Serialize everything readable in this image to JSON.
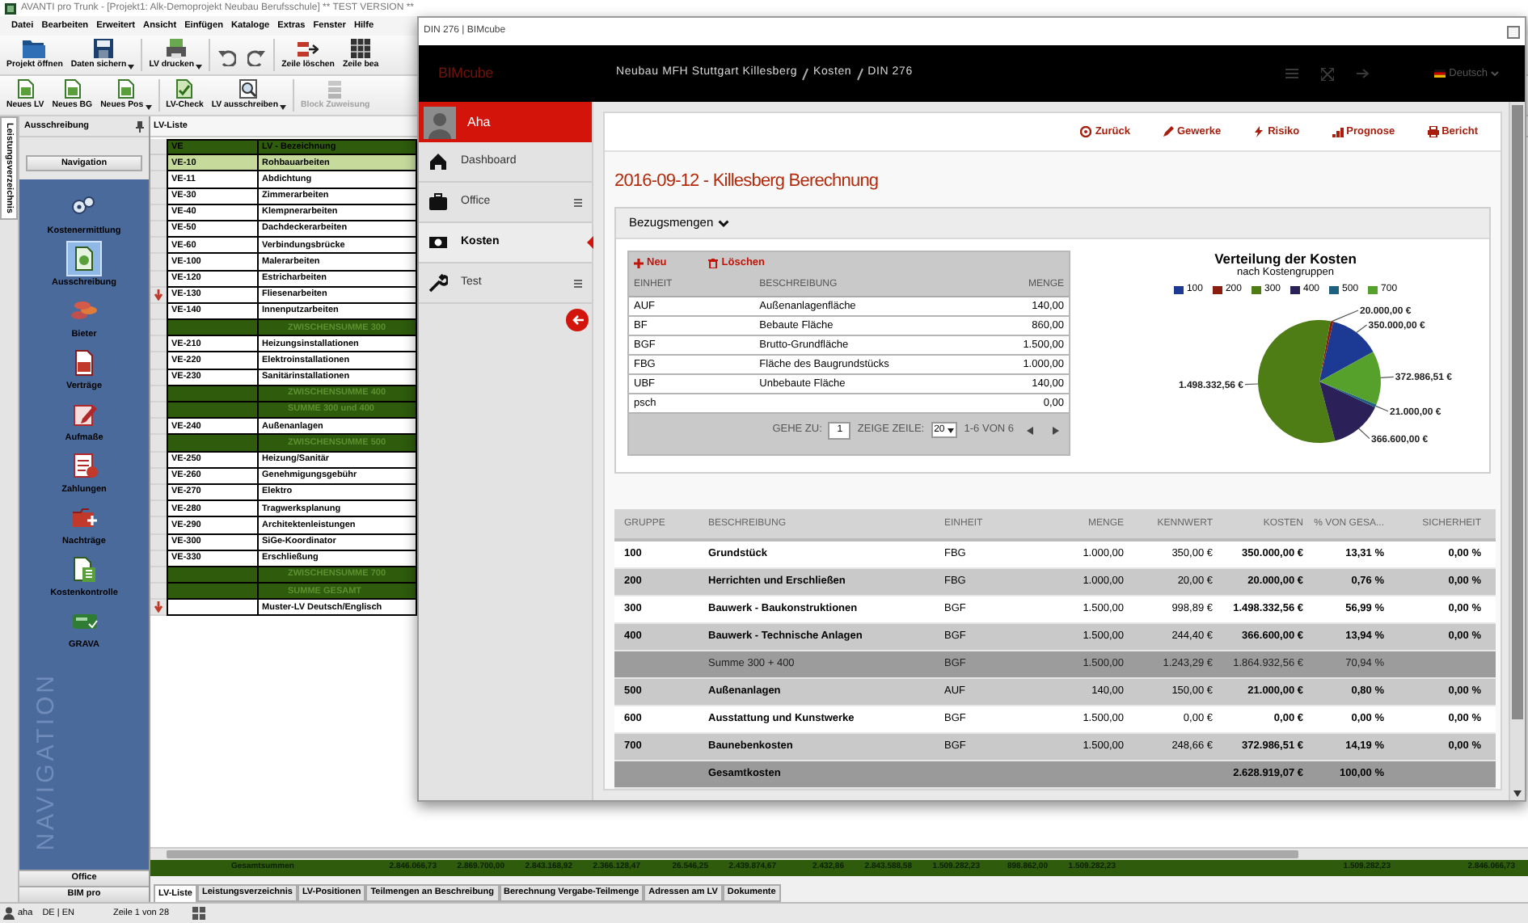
{
  "back_window": {
    "title": "AVANTI pro Trunk - [Projekt1: Alk-Demoprojekt Neubau Berufsschule]  ** TEST VERSION **",
    "menu": [
      "Datei",
      "Bearbeiten",
      "Erweitert",
      "Ansicht",
      "Einfügen",
      "Kataloge",
      "Extras",
      "Fenster",
      "Hilfe"
    ],
    "toolbar_rows": [
      [
        [
          {
            "kind": "button",
            "label": "Projekt öffnen",
            "dropdown": false,
            "disabled": false
          },
          {
            "kind": "button",
            "label": "Daten sichern",
            "dropdown": true,
            "disabled": false
          }
        ],
        [
          {
            "kind": "button",
            "label": "LV drucken",
            "dropdown": true,
            "disabled": false
          }
        ],
        [
          {
            "kind": "undo"
          },
          {
            "kind": "redo"
          }
        ],
        [
          {
            "kind": "button",
            "label": "Zeile löschen",
            "dropdown": false,
            "disabled": false
          },
          {
            "kind": "button",
            "label": "Zeile bea",
            "dropdown": false,
            "disabled": false
          }
        ]
      ],
      [
        [
          {
            "kind": "button",
            "label": "Neues LV",
            "dropdown": false,
            "disabled": false
          },
          {
            "kind": "button",
            "label": "Neues BG",
            "dropdown": false,
            "disabled": false
          },
          {
            "kind": "button",
            "label": "Neues Pos",
            "dropdown": true,
            "disabled": false
          }
        ],
        [
          {
            "kind": "button",
            "label": "LV-Check",
            "dropdown": false,
            "disabled": false
          },
          {
            "kind": "button",
            "label": "LV ausschreiben",
            "dropdown": true,
            "disabled": false
          }
        ],
        [
          {
            "kind": "button",
            "label": "Block Zuweisung",
            "dropdown": false,
            "disabled": true
          }
        ]
      ]
    ],
    "side_tab": "Leistungsverzeichnis",
    "panel_title": "Ausschreibung",
    "navigation_button": "Navigation",
    "nav_items": [
      {
        "label": "Kostenermittlung",
        "selected": false
      },
      {
        "label": "Ausschreibung",
        "selected": true
      },
      {
        "label": "Bieter",
        "selected": false
      },
      {
        "label": "Verträge",
        "selected": false
      },
      {
        "label": "Aufmaße",
        "selected": false
      },
      {
        "label": "Zahlungen",
        "selected": false
      },
      {
        "label": "Nachträge",
        "selected": false
      },
      {
        "label": "Kostenkontrolle",
        "selected": false
      },
      {
        "label": "GRAVA",
        "selected": false
      }
    ],
    "nav_watermark": "NAVIGATION",
    "nav_footer": [
      "Office",
      "BIM pro"
    ],
    "list_title": "LV-Liste",
    "lv_table": {
      "columns": [
        "VE",
        "LV - Bezeichnung"
      ],
      "rows": [
        {
          "kind": "item",
          "ve": "VE-10",
          "name": "Rohbauarbeiten",
          "selected": true,
          "flagged": false
        },
        {
          "kind": "item",
          "ve": "VE-11",
          "name": "Abdichtung",
          "selected": false,
          "flagged": false
        },
        {
          "kind": "item",
          "ve": "VE-30",
          "name": "Zimmerarbeiten",
          "selected": false,
          "flagged": false
        },
        {
          "kind": "item",
          "ve": "VE-40",
          "name": "Klempnerarbeiten",
          "selected": false,
          "flagged": false
        },
        {
          "kind": "item",
          "ve": "VE-50",
          "name": "Dachdeckerarbeiten",
          "selected": false,
          "flagged": false
        },
        {
          "kind": "item",
          "ve": "VE-60",
          "name": "Verbindungsbrücke",
          "selected": false,
          "flagged": false
        },
        {
          "kind": "item",
          "ve": "VE-100",
          "name": "Malerarbeiten",
          "selected": false,
          "flagged": false
        },
        {
          "kind": "item",
          "ve": "VE-120",
          "name": "Estricharbeiten",
          "selected": false,
          "flagged": false
        },
        {
          "kind": "item",
          "ve": "VE-130",
          "name": "Fliesenarbeiten",
          "selected": false,
          "flagged": true
        },
        {
          "kind": "item",
          "ve": "VE-140",
          "name": "Innenputzarbeiten",
          "selected": false,
          "flagged": false
        },
        {
          "kind": "subtotal",
          "name": "ZWISCHENSUMME 300",
          "selected": false,
          "flagged": false
        },
        {
          "kind": "item",
          "ve": "VE-210",
          "name": "Heizungsinstallationen",
          "selected": false,
          "flagged": false
        },
        {
          "kind": "item",
          "ve": "VE-220",
          "name": "Elektroinstallationen",
          "selected": false,
          "flagged": false
        },
        {
          "kind": "item",
          "ve": "VE-230",
          "name": "Sanitärinstallationen",
          "selected": false,
          "flagged": false
        },
        {
          "kind": "subtotal",
          "name": "ZWISCHENSUMME 400",
          "selected": false,
          "flagged": false
        },
        {
          "kind": "subtotal",
          "name": "SUMME 300 und 400",
          "selected": false,
          "flagged": false
        },
        {
          "kind": "item",
          "ve": "VE-240",
          "name": "Außenanlagen",
          "selected": false,
          "flagged": false
        },
        {
          "kind": "subtotal",
          "name": "ZWISCHENSUMME 500",
          "selected": false,
          "flagged": false
        },
        {
          "kind": "item",
          "ve": "VE-250",
          "name": "Heizung/Sanitär",
          "selected": false,
          "flagged": false
        },
        {
          "kind": "item",
          "ve": "VE-260",
          "name": "Genehmigungsgebühr",
          "selected": false,
          "flagged": false
        },
        {
          "kind": "item",
          "ve": "VE-270",
          "name": "Elektro",
          "selected": false,
          "flagged": false
        },
        {
          "kind": "item",
          "ve": "VE-280",
          "name": "Tragwerksplanung",
          "selected": false,
          "flagged": false
        },
        {
          "kind": "item",
          "ve": "VE-290",
          "name": "Architektenleistungen",
          "selected": false,
          "flagged": false
        },
        {
          "kind": "item",
          "ve": "VE-300",
          "name": "SiGe-Koordinator",
          "selected": false,
          "flagged": false
        },
        {
          "kind": "item",
          "ve": "VE-330",
          "name": "Erschließung",
          "selected": false,
          "flagged": false
        },
        {
          "kind": "subtotal",
          "name": "ZWISCHENSUMME 700",
          "selected": false,
          "flagged": false
        },
        {
          "kind": "subtotal",
          "name": "SUMME GESAMT",
          "selected": false,
          "flagged": false
        },
        {
          "kind": "item",
          "name": "Muster-LV Deutsch/Englisch",
          "selected": false,
          "flagged": true
        }
      ]
    },
    "totals_row": {
      "label": "Gesamtsummen",
      "values": [
        "2.846.066,73",
        "2.869.700,00",
        "2.843.168,92",
        "2.366.128,47",
        "26.546,25",
        "2.439.874,67",
        "2.432,86",
        "2.843.588,58",
        "1.509.282,23",
        "898.862,00",
        "1.509.282,23"
      ],
      "right_values": [
        "1.509.282,23",
        "2.846.066,73"
      ]
    },
    "bottom_tabs": [
      {
        "label": "LV-Liste",
        "selected": true
      },
      {
        "label": "Leistungsverzeichnis",
        "selected": false
      },
      {
        "label": "LV-Positionen",
        "selected": false
      },
      {
        "label": "Teilmengen an Beschreibung",
        "selected": false
      },
      {
        "label": "Berechnung Vergabe-Teilmenge",
        "selected": false
      },
      {
        "label": "Adressen am LV",
        "selected": false
      },
      {
        "label": "Dokumente",
        "selected": false
      }
    ],
    "status_bar": {
      "user": "aha",
      "languages": "DE | EN",
      "position": "Zeile 1 von 28"
    }
  },
  "front_window": {
    "title": "DIN 276 | BIMcube",
    "logo": "BIMcube",
    "breadcrumb": [
      "Neubau MFH Stuttgart Killesberg",
      "Kosten",
      "DIN 276"
    ],
    "language": "Deutsch",
    "user": "Aha",
    "sidebar_items": [
      {
        "label": "Dashboard",
        "selected": false,
        "submenu": false
      },
      {
        "label": "Office",
        "selected": false,
        "submenu": true
      },
      {
        "label": "Kosten",
        "selected": true,
        "submenu": false
      },
      {
        "label": "Test",
        "selected": false,
        "submenu": true
      }
    ],
    "actions": [
      "Zurück",
      "Gewerke",
      "Risiko",
      "Prognose",
      "Bericht"
    ],
    "heading": "2016-09-12 - Killesberg Berechnung",
    "panel": {
      "title": "Bezugsmengen",
      "toolbar": [
        "Neu",
        "Löschen"
      ],
      "columns": [
        "EINHEIT",
        "BESCHREIBUNG",
        "MENGE"
      ],
      "rows": [
        {
          "unit": "AUF",
          "description": "Außenanlagenfläche",
          "quantity": "140,00"
        },
        {
          "unit": "BF",
          "description": "Bebaute Fläche",
          "quantity": "860,00"
        },
        {
          "unit": "BGF",
          "description": "Brutto-Grundfläche",
          "quantity": "1.500,00"
        },
        {
          "unit": "FBG",
          "description": "Fläche des Baugrundstücks",
          "quantity": "1.000,00"
        },
        {
          "unit": "UBF",
          "description": "Unbebaute Fläche",
          "quantity": "140,00"
        },
        {
          "unit": "psch",
          "quantity": "0,00"
        }
      ],
      "pager": {
        "goto_label": "GEHE ZU:",
        "page": "1",
        "rows_label": "ZEIGE ZEILE:",
        "rows_per_page": "20",
        "range": "1-6 VON 6"
      },
      "chart": {
        "subtitle": "nach Kostengruppen",
        "chart_data": {
          "type": "pie",
          "title": "Verteilung der Kosten",
          "legend": "top",
          "categories": [
            "100",
            "200",
            "300",
            "400",
            "500",
            "700"
          ],
          "colors": [
            "#1c3a94",
            "#8a1c10",
            "#4e7d16",
            "#2b2158",
            "#1f5f80",
            "#56a02c"
          ],
          "values": [
            350000,
            20000,
            1498332.56,
            366600,
            21000,
            372986.51
          ],
          "data_labels": true,
          "value_labels": [
            "350.000,00 €",
            "20.000,00 €",
            "1.498.332,56 €",
            "366.600,00 €",
            "21.000,00 €",
            "372.986,51 €"
          ]
        }
      }
    },
    "cost_table": {
      "columns": [
        "GRUPPE",
        "BESCHREIBUNG",
        "EINHEIT",
        "MENGE",
        "KENNWERT",
        "KOSTEN",
        "% VON GESA...",
        "SICHERHEIT"
      ],
      "rows": [
        {
          "kind": "group",
          "group": "100",
          "description": "Grundstück",
          "unit": "FBG",
          "quantity": "1.000,00",
          "kennwert": "350,00 €",
          "costs": "350.000,00 €",
          "share": "13,31 %",
          "safety": "0,00 %"
        },
        {
          "kind": "group",
          "group": "200",
          "description": "Herrichten und Erschließen",
          "unit": "FBG",
          "quantity": "1.000,00",
          "kennwert": "20,00 €",
          "costs": "20.000,00 €",
          "share": "0,76 %",
          "safety": "0,00 %"
        },
        {
          "kind": "group",
          "group": "300",
          "description": "Bauwerk - Baukonstruktionen",
          "unit": "BGF",
          "quantity": "1.500,00",
          "kennwert": "998,89 €",
          "costs": "1.498.332,56 €",
          "share": "56,99 %",
          "safety": "0,00 %"
        },
        {
          "kind": "group",
          "group": "400",
          "description": "Bauwerk - Technische Anlagen",
          "unit": "BGF",
          "quantity": "1.500,00",
          "kennwert": "244,40 €",
          "costs": "366.600,00 €",
          "share": "13,94 %",
          "safety": "0,00 %"
        },
        {
          "kind": "sum",
          "description": "Summe 300 + 400",
          "unit": "BGF",
          "quantity": "1.500,00",
          "kennwert": "1.243,29 €",
          "costs": "1.864.932,56 €",
          "share": "70,94 %"
        },
        {
          "kind": "group",
          "group": "500",
          "description": "Außenanlagen",
          "unit": "AUF",
          "quantity": "140,00",
          "kennwert": "150,00 €",
          "costs": "21.000,00 €",
          "share": "0,80 %",
          "safety": "0,00 %"
        },
        {
          "kind": "group",
          "group": "600",
          "description": "Ausstattung und Kunstwerke",
          "unit": "BGF",
          "quantity": "1.500,00",
          "kennwert": "0,00 €",
          "costs": "0,00 €",
          "share": "0,00 %",
          "safety": "0,00 %"
        },
        {
          "kind": "group",
          "group": "700",
          "description": "Baunebenkosten",
          "unit": "BGF",
          "quantity": "1.500,00",
          "kennwert": "248,66 €",
          "costs": "372.986,51 €",
          "share": "14,19 %",
          "safety": "0,00 %"
        },
        {
          "kind": "total",
          "description": "Gesamtkosten",
          "costs": "2.628.919,07 €",
          "share": "100,00 %"
        }
      ]
    }
  }
}
